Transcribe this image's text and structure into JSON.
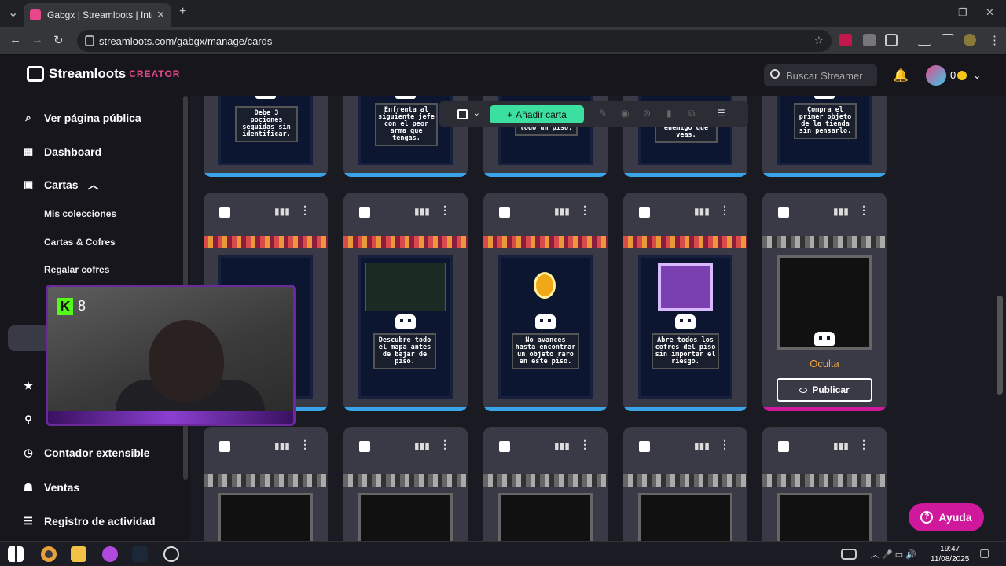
{
  "browser": {
    "tab_title": "Gabgx | Streamloots | Interactiv",
    "url": "streamloots.com/gabgx/manage/cards"
  },
  "header": {
    "logo": "Streamloots",
    "logo_suffix": "CREATOR",
    "search_placeholder": "Buscar Streamer",
    "coins": "0"
  },
  "sidebar": {
    "public_page": "Ver página pública",
    "dashboard": "Dashboard",
    "cards": "Cartas",
    "collections": "Mis colecciones",
    "cards_chests": "Cartas & Cofres",
    "gift_chests": "Regalar cofres",
    "counter": "Contador extensible",
    "sales": "Ventas",
    "activity": "Registro de actividad"
  },
  "toolbar": {
    "add_card": "Añadir carta"
  },
  "cards_top": [
    "Debe 3 pociones seguidas sin identificar.",
    "Enfrenta al siguiente jefe con el peor arma que tengas.",
    "escudo durante todo un piso.",
    "próximo enemigo que veas.",
    "Compra el primer objeto de la tienda sin pensarlo."
  ],
  "cards_mid": [
    {
      "text": ""
    },
    {
      "text": "Descubre todo el mapa antes de bajar de piso."
    },
    {
      "text": "No avances hasta encontrar un objeto raro en este piso."
    },
    {
      "text": "Abre todos los cofres del piso sin importar el riesgo."
    },
    {
      "text": ""
    }
  ],
  "hidden_card": {
    "status": "Oculta",
    "publish": "Publicar"
  },
  "webcam": {
    "viewers": "8"
  },
  "help": "Ayuda",
  "taskbar": {
    "time": "19:47",
    "date": "11/08/2025"
  }
}
